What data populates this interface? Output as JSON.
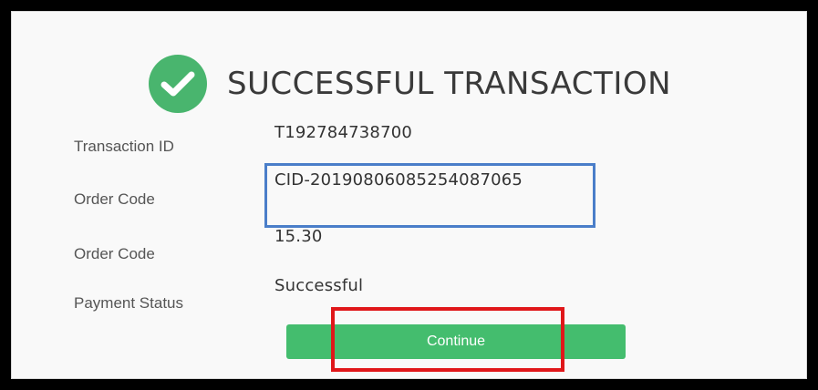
{
  "header": {
    "icon": "check-circle-icon",
    "title": "SUCCESSFUL TRANSACTION"
  },
  "details": [
    {
      "label": "Transaction ID",
      "value": "T192784738700"
    },
    {
      "label": "Order Code",
      "value": "CID-20190806085254087065"
    },
    {
      "label": "Order Code",
      "value": "15.30"
    },
    {
      "label": "Payment Status",
      "value": "Successful"
    }
  ],
  "actions": {
    "continue_label": "Continue"
  },
  "colors": {
    "success": "#49b56e",
    "button": "#44bd6e",
    "highlight_blue": "#4a7ec9",
    "highlight_red": "#e0171a"
  }
}
